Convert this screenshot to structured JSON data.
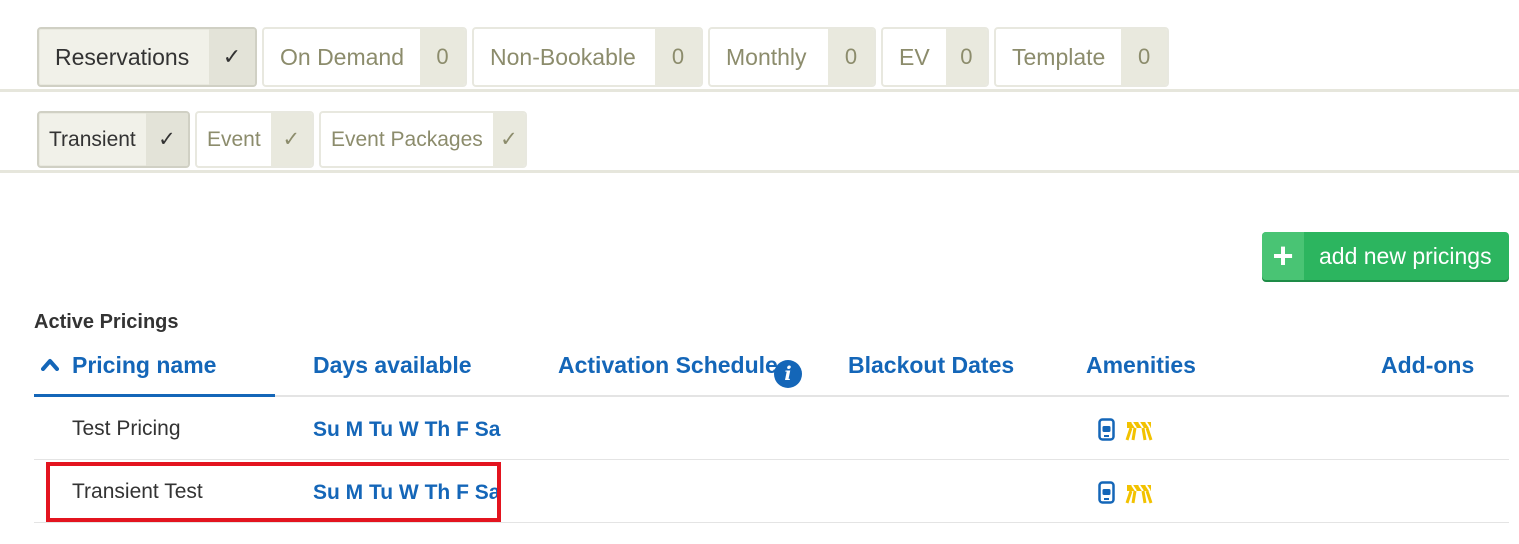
{
  "tabs_primary": [
    {
      "label": "Reservations",
      "count": "✓",
      "active": true
    },
    {
      "label": "On Demand",
      "count": "0",
      "active": false
    },
    {
      "label": "Non-Bookable",
      "count": "0",
      "active": false
    },
    {
      "label": "Monthly",
      "count": "0",
      "active": false
    },
    {
      "label": "EV",
      "count": "0",
      "active": false
    },
    {
      "label": "Template",
      "count": "0",
      "active": false
    }
  ],
  "tabs_secondary": [
    {
      "label": "Transient",
      "count": "✓",
      "active": true
    },
    {
      "label": "Event",
      "count": "✓",
      "active": false
    },
    {
      "label": "Event Packages",
      "count": "✓",
      "active": false
    }
  ],
  "add_button": {
    "label": "add new pricings",
    "icon": "plus-icon",
    "color": "#2cb55f"
  },
  "section_title": "Active Pricings",
  "table": {
    "columns": {
      "pricing_name": "Pricing name",
      "days_available": "Days available",
      "activation_schedule": "Activation Schedule",
      "blackout_dates": "Blackout Dates",
      "amenities": "Amenities",
      "addons": "Add-ons"
    },
    "info_icon_glyph": "i",
    "rows": [
      {
        "name": "Test Pricing",
        "days": "Su M Tu W Th F Sa",
        "amenities": [
          "mobile-icon",
          "barrier-icon"
        ]
      },
      {
        "name": "Transient Test",
        "days": "Su M Tu W Th F Sa",
        "amenities": [
          "mobile-icon",
          "barrier-icon"
        ]
      }
    ]
  },
  "colors": {
    "link_blue": "#1466b8",
    "highlight_red": "#e3141f",
    "amenity_yellow": "#f2c200"
  }
}
